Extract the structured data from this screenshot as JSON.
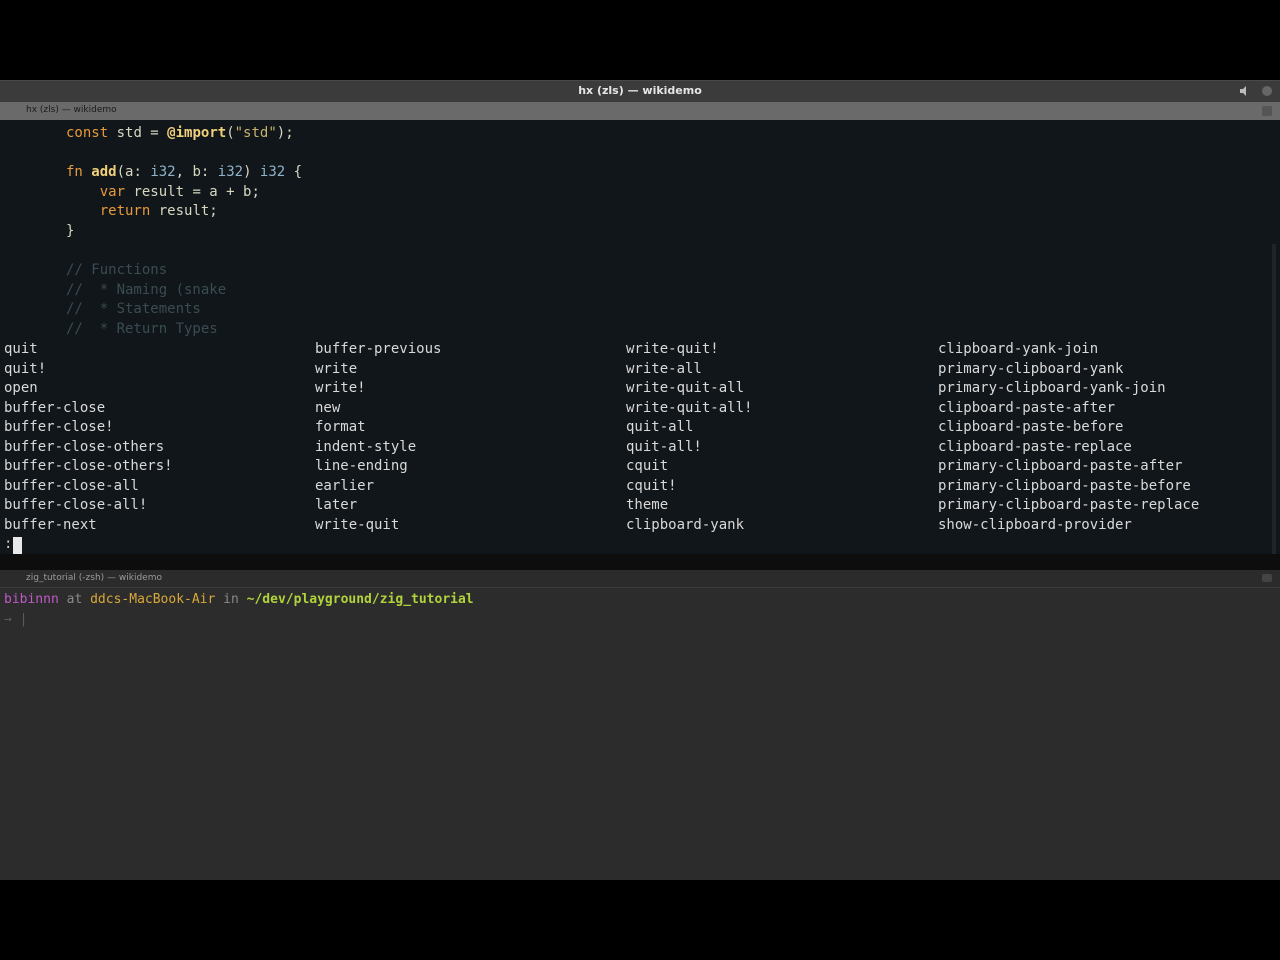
{
  "window": {
    "title": "hx (zls) — wikidemo"
  },
  "editor_tab": {
    "label": "hx (zls) — wikidemo"
  },
  "editor": {
    "lines": [
      [
        {
          "t": "const",
          "c": "kw"
        },
        {
          "t": " std = ",
          "c": "txt"
        },
        {
          "t": "@import",
          "c": "fn"
        },
        {
          "t": "(",
          "c": "txt"
        },
        {
          "t": "\"std\"",
          "c": "str"
        },
        {
          "t": ");",
          "c": "txt"
        }
      ],
      [],
      [
        {
          "t": "fn ",
          "c": "kw"
        },
        {
          "t": "add",
          "c": "fn"
        },
        {
          "t": "(a: ",
          "c": "txt"
        },
        {
          "t": "i32",
          "c": "ty"
        },
        {
          "t": ", b: ",
          "c": "txt"
        },
        {
          "t": "i32",
          "c": "ty"
        },
        {
          "t": ") ",
          "c": "txt"
        },
        {
          "t": "i32",
          "c": "ty"
        },
        {
          "t": " {",
          "c": "txt"
        }
      ],
      [
        {
          "t": "    var",
          "c": "kw"
        },
        {
          "t": " result = a + b;",
          "c": "txt"
        }
      ],
      [
        {
          "t": "    return",
          "c": "kw"
        },
        {
          "t": " result;",
          "c": "txt"
        }
      ],
      [
        {
          "t": "}",
          "c": "txt"
        }
      ],
      [],
      [
        {
          "t": "// Functions",
          "c": "cmt"
        }
      ],
      [
        {
          "t": "//  * Naming (snake",
          "c": "cmt"
        }
      ],
      [
        {
          "t": "//  * Statements",
          "c": "cmt"
        }
      ],
      [
        {
          "t": "//  * Return Types",
          "c": "cmt"
        }
      ]
    ]
  },
  "completion_menu": {
    "columns": [
      [
        "quit",
        "quit!",
        "open",
        "buffer-close",
        "buffer-close!",
        "buffer-close-others",
        "buffer-close-others!",
        "buffer-close-all",
        "buffer-close-all!",
        "buffer-next"
      ],
      [
        "buffer-previous",
        "write",
        "write!",
        "new",
        "format",
        "indent-style",
        "line-ending",
        "earlier",
        "later",
        "write-quit"
      ],
      [
        "write-quit!",
        "write-all",
        "write-quit-all",
        "write-quit-all!",
        "quit-all",
        "quit-all!",
        "cquit",
        "cquit!",
        "theme",
        "clipboard-yank"
      ],
      [
        "clipboard-yank-join",
        "primary-clipboard-yank",
        "primary-clipboard-yank-join",
        "clipboard-paste-after",
        "clipboard-paste-before",
        "clipboard-paste-replace",
        "primary-clipboard-paste-after",
        "primary-clipboard-paste-before",
        "primary-clipboard-paste-replace",
        "show-clipboard-provider"
      ]
    ]
  },
  "command_line": {
    "prompt": ":"
  },
  "terminal_tab": {
    "label": "zig_tutorial (-zsh) — wikidemo"
  },
  "terminal": {
    "user": "bibinnn",
    "at": " at ",
    "host": "ddcs-MacBook-Air",
    "in": " in ",
    "path": "~/dev/playground/zig_tutorial",
    "second_prompt": "→ |"
  },
  "colors": {
    "editor_bg": "#11161a",
    "terminal_bg": "#2c2c2c",
    "keyword": "#e89a3c",
    "function": "#f0d07a"
  }
}
